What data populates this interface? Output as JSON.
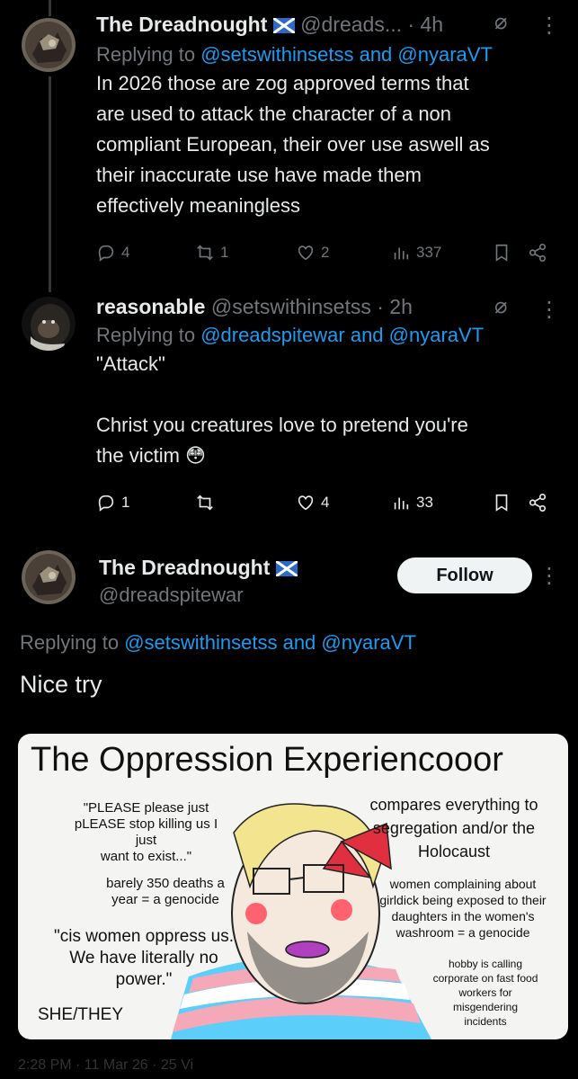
{
  "tweet1": {
    "name": "The Dreadnought",
    "handle": "@dreads...",
    "time": "· 4h",
    "replying_label": "Replying to",
    "replying_users": "@setswithinsetss and @nyaraVT",
    "text_lines": [
      "In 2026 those are zog approved terms that",
      "are used to attack the character of a non",
      "compliant European, their over use aswell as",
      "their inaccurate use have made them",
      "effectively meaningless"
    ],
    "replies": "4",
    "reposts": "1",
    "likes": "2",
    "views": "337"
  },
  "tweet2": {
    "name": "reasonable",
    "handle": "@setswithinsetss",
    "time": "· 2h",
    "replying_label": "Replying to",
    "replying_users": "@dreadspitewar and @nyaraVT",
    "text_line1": "\"Attack\"",
    "text_line2": "Christ you creatures love to pretend you're",
    "text_line3": "the victim 😳",
    "replies": "1",
    "reposts": "",
    "likes": "4",
    "views": "33"
  },
  "main_tweet": {
    "name": "The Dreadnought",
    "handle": "@dreadspitewar",
    "follow_label": "Follow",
    "replying_label": "Replying to",
    "replying_users": "@setswithinsetss and @nyaraVT",
    "text": "Nice try"
  },
  "meme": {
    "title": "The Oppression Experiencooor",
    "lines": {
      "please_1": "\"PLEASE please just",
      "please_2": "pLEASE stop killing us I just",
      "please_3": "want to exist...\"",
      "deaths_1": "barely 350 deaths a",
      "deaths_2": "year = a genocide",
      "cis_1": "\"cis women oppress us.",
      "cis_2": "We have literally no",
      "cis_3": "power.\"",
      "shethey": "SHE/THEY",
      "compares_1": "compares everything to",
      "compares_2": "segregation and/or the",
      "compares_3": "Holocaust",
      "women_1": "women complaining about",
      "women_2": "girldick being exposed to their",
      "women_3": "daughters in the women's",
      "women_4": "washroom = a genocide",
      "hobby_1": "hobby is calling",
      "hobby_2": "corporate on fast food",
      "hobby_3": "workers for",
      "hobby_4": "misgendering",
      "hobby_5": "incidents"
    }
  },
  "footer_partial": "2:28 PM · 11 Mar 26 · 25 Vi",
  "colors": {
    "background": "#000000",
    "link": "#1d9bf0",
    "muted": "#71767b",
    "text": "#e7e9ea",
    "follow_bg": "#eff3f4"
  }
}
